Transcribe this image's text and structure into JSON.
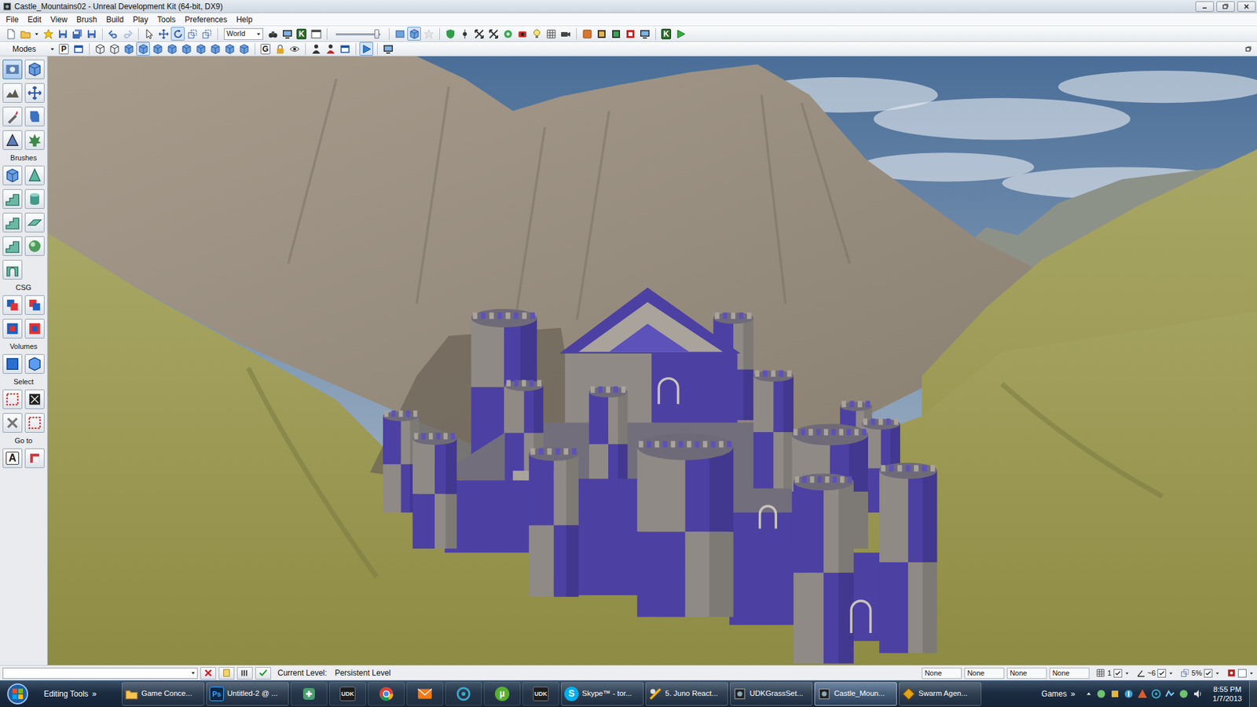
{
  "window": {
    "title": "Castle_Mountains02 - Unreal Development Kit (64-bit, DX9)"
  },
  "menu": [
    "File",
    "Edit",
    "View",
    "Brush",
    "Build",
    "Play",
    "Tools",
    "Preferences",
    "Help"
  ],
  "toolbar": [
    {
      "kind": "button",
      "pressed": false,
      "disabled": false
    },
    {
      "kind": "button",
      "pressed": false,
      "disabled": false
    },
    {
      "kind": "arrow",
      "pressed": false,
      "disabled": false
    },
    {
      "kind": "button",
      "pressed": false,
      "disabled": false
    },
    {
      "kind": "button",
      "pressed": false,
      "disabled": false
    },
    {
      "kind": "button",
      "pressed": false,
      "disabled": false
    },
    {
      "kind": "button",
      "pressed": false,
      "disabled": false
    },
    {
      "kind": "separator",
      "pressed": false,
      "disabled": false
    },
    {
      "kind": "button",
      "pressed": false,
      "disabled": false
    },
    {
      "kind": "button",
      "pressed": false,
      "disabled": true
    },
    {
      "kind": "separator",
      "pressed": false,
      "disabled": false
    },
    {
      "kind": "button",
      "pressed": false,
      "disabled": false
    },
    {
      "kind": "button",
      "pressed": false,
      "disabled": false
    },
    {
      "kind": "button",
      "pressed": true,
      "disabled": false
    },
    {
      "kind": "button",
      "pressed": false,
      "disabled": false
    },
    {
      "kind": "button",
      "pressed": false,
      "disabled": false
    },
    {
      "kind": "separator",
      "pressed": false,
      "disabled": false
    },
    {
      "kind": "dropdown",
      "label": "World",
      "pressed": false,
      "disabled": false
    },
    {
      "kind": "button",
      "pressed": false,
      "disabled": false
    },
    {
      "kind": "button",
      "pressed": false,
      "disabled": false
    },
    {
      "kind": "button",
      "label": "K",
      "pressed": false,
      "disabled": false
    },
    {
      "kind": "button",
      "pressed": false,
      "disabled": false
    },
    {
      "kind": "separator",
      "pressed": false,
      "disabled": false
    },
    {
      "kind": "slider",
      "level": 0.92,
      "pressed": false,
      "disabled": false
    },
    {
      "kind": "separator",
      "pressed": false,
      "disabled": false
    },
    {
      "kind": "button",
      "pressed": false,
      "disabled": false
    },
    {
      "kind": "button",
      "pressed": true,
      "disabled": false
    },
    {
      "kind": "button",
      "pressed": false,
      "disabled": true
    },
    {
      "kind": "separator",
      "pressed": false,
      "disabled": false
    },
    {
      "kind": "button",
      "pressed": false,
      "disabled": false
    },
    {
      "kind": "button",
      "pressed": false,
      "disabled": false
    },
    {
      "kind": "button",
      "pressed": false,
      "disabled": false
    },
    {
      "kind": "button",
      "pressed": false,
      "disabled": false
    },
    {
      "kind": "button",
      "pressed": false,
      "disabled": false
    },
    {
      "kind": "button",
      "pressed": false,
      "disabled": false
    },
    {
      "kind": "button",
      "pressed": false,
      "disabled": false
    },
    {
      "kind": "button",
      "pressed": false,
      "disabled": false
    },
    {
      "kind": "button",
      "pressed": false,
      "disabled": false
    },
    {
      "kind": "separator",
      "pressed": false,
      "disabled": false
    },
    {
      "kind": "button",
      "pressed": false,
      "disabled": false
    },
    {
      "kind": "button",
      "pressed": false,
      "disabled": false
    },
    {
      "kind": "button",
      "pressed": false,
      "disabled": false
    },
    {
      "kind": "button",
      "pressed": false,
      "disabled": false
    },
    {
      "kind": "button",
      "pressed": false,
      "disabled": false
    },
    {
      "kind": "separator",
      "pressed": false,
      "disabled": false
    },
    {
      "kind": "button",
      "label": "K",
      "pressed": false,
      "disabled": false
    },
    {
      "kind": "button",
      "pressed": false,
      "disabled": false
    }
  ],
  "modes_bar": {
    "label": "Modes",
    "items": [
      {
        "kind": "arrow",
        "pressed": false
      },
      {
        "kind": "button",
        "label": "P",
        "pressed": false
      },
      {
        "kind": "button",
        "pressed": false
      },
      {
        "kind": "separator",
        "pressed": false
      },
      {
        "kind": "button",
        "pressed": false
      },
      {
        "kind": "button",
        "pressed": false
      },
      {
        "kind": "button",
        "pressed": false
      },
      {
        "kind": "button",
        "pressed": true
      },
      {
        "kind": "button",
        "pressed": false
      },
      {
        "kind": "button",
        "pressed": false
      },
      {
        "kind": "button",
        "pressed": false
      },
      {
        "kind": "button",
        "pressed": false
      },
      {
        "kind": "button",
        "pressed": false
      },
      {
        "kind": "button",
        "pressed": false
      },
      {
        "kind": "button",
        "pressed": false
      },
      {
        "kind": "separator",
        "pressed": false
      },
      {
        "kind": "button",
        "label": "G",
        "pressed": false
      },
      {
        "kind": "button",
        "pressed": false
      },
      {
        "kind": "button",
        "pressed": false
      },
      {
        "kind": "separator",
        "pressed": false
      },
      {
        "kind": "button",
        "pressed": false
      },
      {
        "kind": "button",
        "pressed": false
      },
      {
        "kind": "button",
        "pressed": false
      },
      {
        "kind": "separator",
        "pressed": false
      },
      {
        "kind": "button",
        "pressed": true
      },
      {
        "kind": "separator",
        "pressed": false
      },
      {
        "kind": "button",
        "pressed": false
      }
    ]
  },
  "sidebar": {
    "modes": [
      {
        "pressed": true
      },
      {
        "pressed": false
      },
      {
        "pressed": false
      },
      {
        "pressed": false
      },
      {
        "pressed": false
      },
      {
        "pressed": false
      },
      {
        "pressed": false
      },
      {
        "pressed": false
      }
    ],
    "sections": [
      {
        "title": "Brushes",
        "buttons": [
          {
            "pressed": false
          },
          {
            "pressed": false
          },
          {
            "pressed": false
          },
          {
            "pressed": false
          },
          {
            "pressed": false
          },
          {
            "pressed": false
          },
          {
            "pressed": false
          },
          {
            "pressed": false
          },
          {
            "pressed": false
          }
        ]
      },
      {
        "title": "CSG",
        "buttons": [
          {
            "pressed": false
          },
          {
            "pressed": false
          },
          {
            "pressed": false
          },
          {
            "pressed": false
          }
        ]
      },
      {
        "title": "Volumes",
        "buttons": [
          {
            "pressed": false
          },
          {
            "pressed": false
          }
        ]
      },
      {
        "title": "Select",
        "buttons": [
          {
            "pressed": false
          },
          {
            "pressed": false
          },
          {
            "pressed": false
          },
          {
            "pressed": false
          }
        ]
      },
      {
        "title": "Go to",
        "buttons": [
          {
            "label": "A",
            "pressed": false
          },
          {
            "pressed": false
          }
        ]
      }
    ]
  },
  "status_bar": {
    "current_level_label": "Current Level:",
    "current_level": "Persistent Level",
    "fields": [
      "None",
      "None",
      "None",
      "None"
    ],
    "snaps": [
      {
        "kind": "grid",
        "label": "1",
        "checked": true
      },
      {
        "kind": "angle",
        "label": "~6",
        "checked": true
      },
      {
        "kind": "scale",
        "label": "5%",
        "checked": true
      },
      {
        "kind": "vertex",
        "checked": false
      }
    ]
  },
  "taskbar": {
    "toolbar_label": "Editing Tools",
    "toolbar_chevron": "»",
    "items": [
      {
        "kind": "button",
        "label": "Game Conce...",
        "selected": false
      },
      {
        "kind": "button",
        "label": "Untitled-2 @ ...",
        "icon_text": "Ps",
        "selected": false
      },
      {
        "kind": "icon",
        "selected": false
      },
      {
        "kind": "icon",
        "icon_text": "UDK",
        "selected": false
      },
      {
        "kind": "icon",
        "selected": false
      },
      {
        "kind": "icon",
        "selected": false
      },
      {
        "kind": "icon",
        "selected": false
      },
      {
        "kind": "icon",
        "icon_text": "µ",
        "selected": false
      },
      {
        "kind": "icon",
        "icon_text": "UDK",
        "selected": false
      },
      {
        "kind": "button",
        "label": "Skype™ - tor...",
        "icon_text": "S",
        "selected": false
      },
      {
        "kind": "button",
        "label": "5. Juno React...",
        "selected": false
      },
      {
        "kind": "button",
        "label": "UDKGrassSet...",
        "selected": false
      },
      {
        "kind": "button",
        "label": "Castle_Moun...",
        "selected": true
      },
      {
        "kind": "button",
        "label": "Swarm Agen...",
        "selected": false
      }
    ],
    "games_label": "Games",
    "games_chevron": "»",
    "clock": {
      "time": "8:55 PM",
      "date": "1/7/2013"
    }
  }
}
